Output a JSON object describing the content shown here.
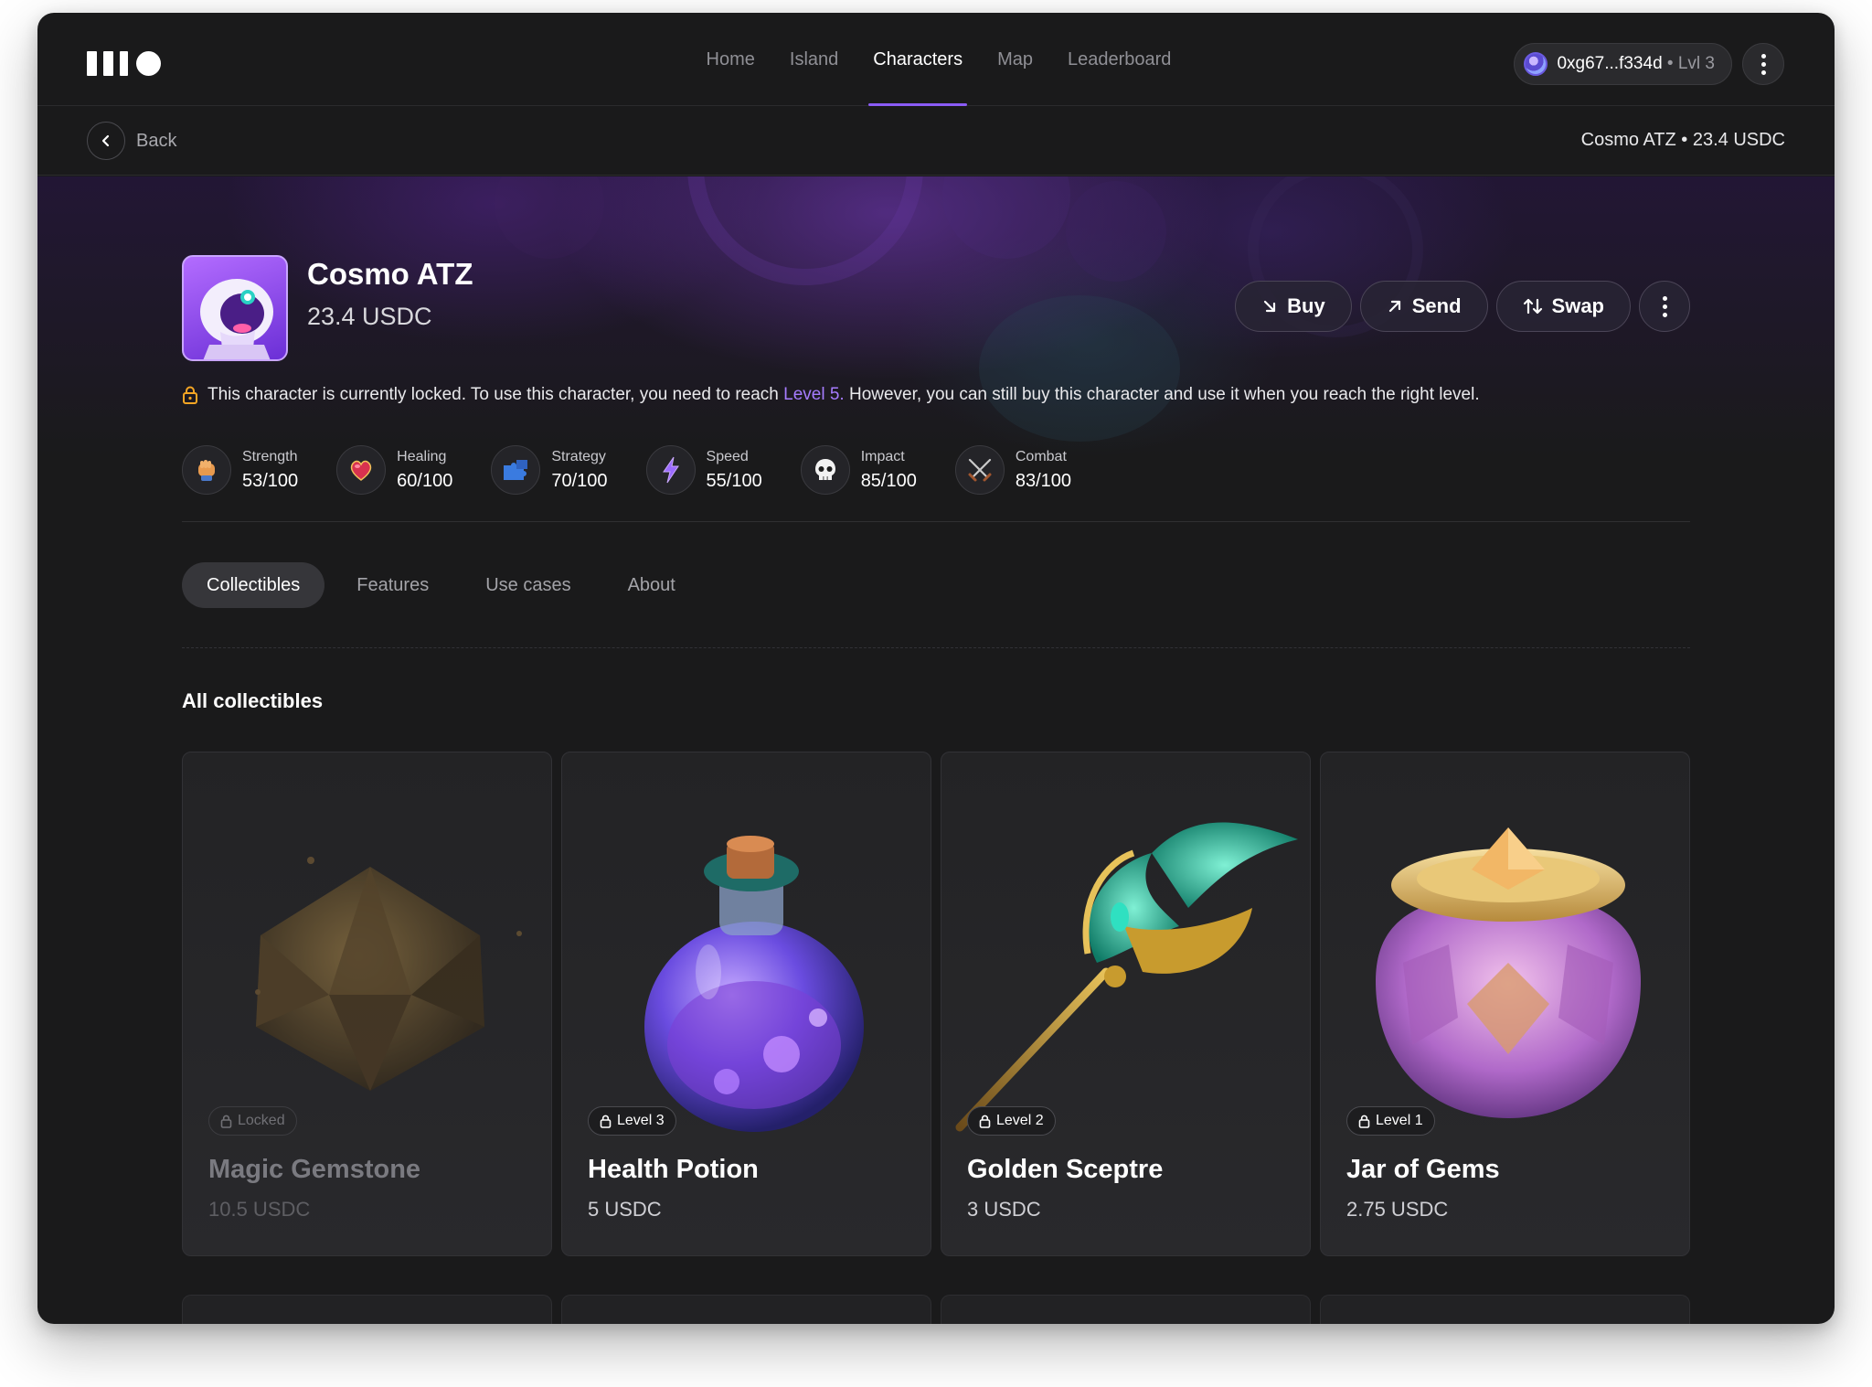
{
  "nav": {
    "items": [
      {
        "label": "Home",
        "active": false
      },
      {
        "label": "Island",
        "active": false
      },
      {
        "label": "Characters",
        "active": true
      },
      {
        "label": "Map",
        "active": false
      },
      {
        "label": "Leaderboard",
        "active": false
      }
    ]
  },
  "wallet": {
    "address": "0xg67...f334d",
    "separator": " • ",
    "level": "Lvl 3"
  },
  "subbar": {
    "back_label": "Back",
    "summary": "Cosmo ATZ • 23.4 USDC"
  },
  "character": {
    "name": "Cosmo ATZ",
    "price": "23.4 USDC",
    "actions": {
      "buy": "Buy",
      "send": "Send",
      "swap": "Swap"
    },
    "lock_note": {
      "prefix": "This character is currently locked. To use this character, you need to reach ",
      "level": "Level 5.",
      "suffix": " However, you can still buy this character and use it when you reach the right level."
    },
    "stats": [
      {
        "label": "Strength",
        "value": "53/100",
        "icon": "fist-icon"
      },
      {
        "label": "Healing",
        "value": "60/100",
        "icon": "heart-icon"
      },
      {
        "label": "Strategy",
        "value": "70/100",
        "icon": "puzzle-icon"
      },
      {
        "label": "Speed",
        "value": "55/100",
        "icon": "lightning-icon"
      },
      {
        "label": "Impact",
        "value": "85/100",
        "icon": "skull-icon"
      },
      {
        "label": "Combat",
        "value": "83/100",
        "icon": "crossed-swords-icon"
      }
    ]
  },
  "tabs": [
    {
      "label": "Collectibles",
      "active": true
    },
    {
      "label": "Features",
      "active": false
    },
    {
      "label": "Use cases",
      "active": false
    },
    {
      "label": "About",
      "active": false
    }
  ],
  "collectibles": {
    "title": "All collectibles",
    "items": [
      {
        "badge": "Locked",
        "name": "Magic Gemstone",
        "price": "10.5 USDC",
        "locked": true,
        "icon": "gemstone-icon"
      },
      {
        "badge": "Level 3",
        "name": "Health Potion",
        "price": "5 USDC",
        "locked": false,
        "icon": "potion-icon"
      },
      {
        "badge": "Level 2",
        "name": "Golden Sceptre",
        "price": "3 USDC",
        "locked": false,
        "icon": "sceptre-icon"
      },
      {
        "badge": "Level 1",
        "name": "Jar of Gems",
        "price": "2.75 USDC",
        "locked": false,
        "icon": "gem-jar-icon"
      }
    ]
  },
  "colors": {
    "accent": "#8b5cf6",
    "level_highlight": "#a67cff",
    "lock_icon": "#f5a524",
    "background": "#1a1a1b"
  }
}
